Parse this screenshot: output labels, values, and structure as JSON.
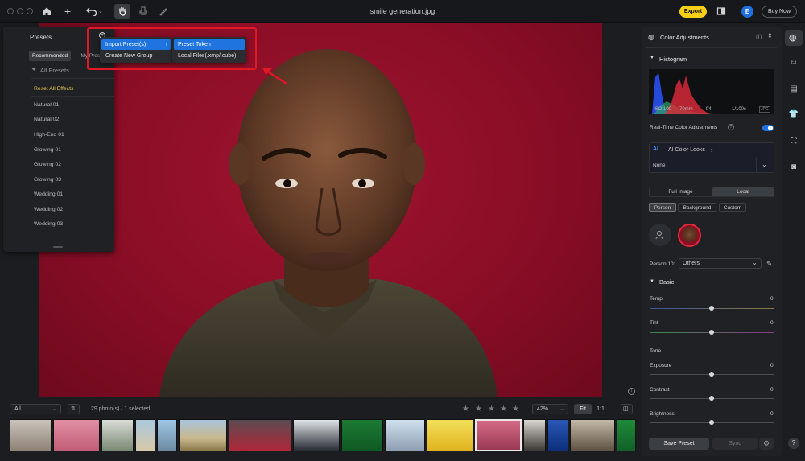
{
  "window": {
    "title": "smile generation.jpg"
  },
  "toolbar": {
    "export_label": "Export",
    "avatar_letter": "E",
    "buy_label": "Buy Now"
  },
  "presets": {
    "title": "Presets",
    "tabs": [
      "Recommended",
      "My Preset"
    ],
    "all_label": "All Presets",
    "reset_label": "Reset All Effects",
    "items": [
      "Natural 01",
      "Natural 02",
      "High-End 01",
      "Glowing 01",
      "Glowing 02",
      "Glowing 03",
      "Wedding 01",
      "Wedding 02",
      "Wedding 03"
    ]
  },
  "context_menu": {
    "import_label": "Import Preset(s)",
    "create_group_label": "Create New Group",
    "preset_token_label": "Preset Token",
    "local_files_label": "Local Files(.xmp/.cube)"
  },
  "bottom": {
    "filter_value": "All",
    "count_text": "29 photo(s) / 1 selected",
    "zoom_value": "42%",
    "fit_label": "Fit",
    "one_to_one_label": "1:1",
    "stars": 0
  },
  "right_panel": {
    "header": "Color Adjustments",
    "histogram_label": "Histogram",
    "exif": {
      "iso": "ISO 100",
      "focal": "70mm",
      "aperture": "f/4",
      "shutter": "1/100s",
      "format": "JPG"
    },
    "realtime_label": "Real-Time Color Adjustments",
    "realtime_on": true,
    "ai_looks_label": "AI Color Looks",
    "ai_icon_text": "AI",
    "ai_looks_value": "None",
    "scope_tabs": [
      "Full Image",
      "Local"
    ],
    "scope_active": "Local",
    "target_tabs": [
      "Person",
      "Background",
      "Custom"
    ],
    "target_active": "Person",
    "person_label": "Person 10:",
    "person_value": "Others",
    "basic_label": "Basic",
    "tone_label": "Tone",
    "sliders": [
      {
        "label": "Temp",
        "value": "0"
      },
      {
        "label": "Tint",
        "value": "0"
      },
      {
        "label": "Exposure",
        "value": "0"
      },
      {
        "label": "Contrast",
        "value": "0"
      },
      {
        "label": "Brightness",
        "value": "0"
      }
    ],
    "save_preset_label": "Save Preset",
    "sync_label": "Sync"
  },
  "colors": {
    "accent": "#1f74e0",
    "export": "#f5d017",
    "highlight_box": "#e01825",
    "backdrop": "#8a0d26"
  }
}
